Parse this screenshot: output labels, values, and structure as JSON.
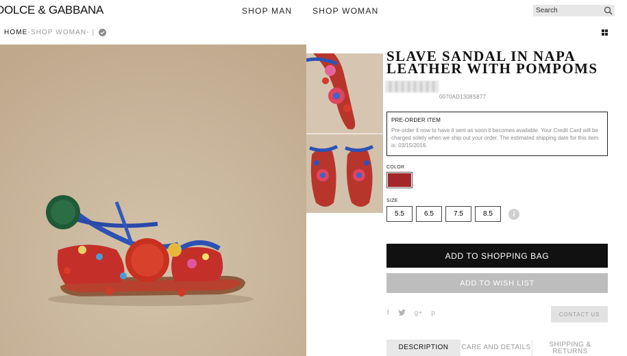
{
  "header": {
    "brand": "DOLCE & GABBANA",
    "nav": [
      "SHOP MAN",
      "SHOP WOMAN"
    ],
    "search_placeholder": "Search"
  },
  "breadcrumb": {
    "home": "HOME",
    "separator": " - ",
    "current": "SHOP WOMAN",
    "trail": " - |"
  },
  "product": {
    "title": "SLAVE SANDAL IN NAPA LEATHER WITH POMPOMS",
    "code": "0070AD1308S877",
    "preorder": {
      "title": "PRE-ORDER ITEM",
      "text": "Pre-order it now to have it sent as soon it becomes available. Your Credit Card will be charged solely when we ship out your order. The estimated shipping date for this item is: 03/15/2016."
    },
    "color_label": "COLOR",
    "color_swatch": "#a3272a",
    "size_label": "SIZE",
    "sizes": [
      "5.5",
      "6.5",
      "7.5",
      "8.5"
    ],
    "add_to_bag": "ADD TO SHOPPING BAG",
    "add_to_wishlist": "ADD TO WISH LIST",
    "social": [
      "f",
      "t",
      "g+",
      "p"
    ],
    "contact": "CONTACT US",
    "tabs": [
      "DESCRIPTION",
      "CARE AND DETAILS",
      "SHIPPING & RETURNS"
    ]
  },
  "colors": {
    "primary_button": "#111111",
    "secondary_button": "#bdbdbd"
  }
}
